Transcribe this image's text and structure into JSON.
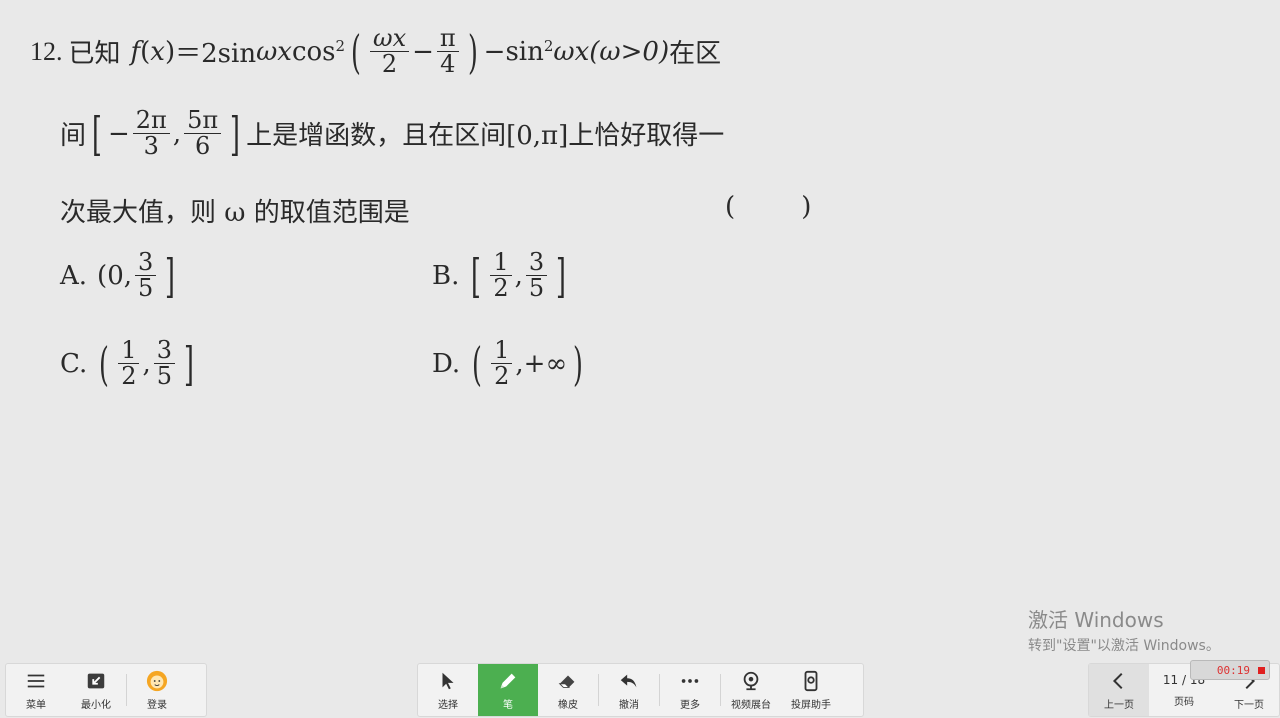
{
  "question": {
    "number": "12.",
    "line1": {
      "intro": "已知",
      "f": "f",
      "lp": "(",
      "x": "x",
      "rp": ")",
      "eq": "＝2sin ",
      "wx": "ωx",
      "cos": "cos",
      "sq": "2",
      "frac1_num": "ωx",
      "frac1_den": "2",
      "minus": "−",
      "frac2_num": "π",
      "frac2_den": "4",
      "tail1": "−sin",
      "tail_sq": "2",
      "tail2": "ωx(ω>0)",
      "tail3": "在区"
    },
    "line2": {
      "pre": "间",
      "neg": "−",
      "f1_num": "2π",
      "f1_den": "3",
      "comma": ",",
      "f2_num": "5π",
      "f2_den": "6",
      "post": "上是增函数，且在区间[0,π]上恰好取得一"
    },
    "line3": {
      "text": "次最大值，则 ω 的取值范围是",
      "blank": "(        )"
    }
  },
  "options": {
    "A": {
      "label": "A.",
      "left": "(0,",
      "num": "3",
      "den": "5",
      "right": "]"
    },
    "B": {
      "label": "B.",
      "left": "[",
      "n1": "1",
      "d1": "2",
      "comma": ",",
      "n2": "3",
      "d2": "5",
      "right": "]"
    },
    "C": {
      "label": "C.",
      "left": "(",
      "n1": "1",
      "d1": "2",
      "comma": ",",
      "n2": "3",
      "d2": "5",
      "right": "]"
    },
    "D": {
      "label": "D.",
      "left": "(",
      "n1": "1",
      "d1": "2",
      "rest": ",+∞",
      "right": ")"
    }
  },
  "watermark": {
    "title": "激活 Windows",
    "subtitle": "转到\"设置\"以激活 Windows。"
  },
  "toolbar": {
    "menu": "菜单",
    "minimize": "最小化",
    "login": "登录",
    "select": "选择",
    "pen": "笔",
    "eraser": "橡皮",
    "undo": "撤消",
    "more": "更多",
    "video_booth": "视频展台",
    "screen_helper": "投屏助手",
    "prev": "上一页",
    "page_counter": "11 / 18",
    "page_label": "页码",
    "next": "下一页",
    "timer": "00:19"
  },
  "colors": {
    "accent": "#4caf50",
    "record": "#e02020"
  }
}
